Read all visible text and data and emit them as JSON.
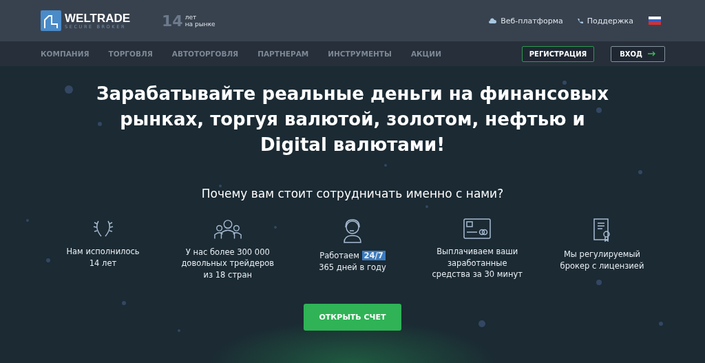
{
  "logo": {
    "name": "WELTRADE",
    "tagline": "SECURE BROKER"
  },
  "years": {
    "number": "14",
    "line1": "лет",
    "line2": "на рынке"
  },
  "top_links": [
    {
      "label": "Веб-платформа",
      "kind": "cloud"
    },
    {
      "label": "Поддержка",
      "kind": "phone"
    }
  ],
  "nav": [
    "КОМПАНИЯ",
    "ТОРГОВЛЯ",
    "АВТОТОРГОВЛЯ",
    "ПАРТНЕРАМ",
    "ИНСТРУМЕНТЫ",
    "АКЦИИ"
  ],
  "register_button": "РЕГИСТРАЦИЯ",
  "login_button": "ВХОД",
  "headline": "Зарабатывайте реальные деньги на финансовых рынках, торгуя валютой, золотом, нефтью и Digital валютами!",
  "subheadline": "Почему вам стоит сотрудничать именно с нами?",
  "features": [
    {
      "lines": [
        "Нам исполнилось",
        "14 лет"
      ]
    },
    {
      "lines": [
        "У нас более 300 000",
        "довольных трейдеров",
        "из 18 стран"
      ]
    },
    {
      "lines": [
        "Работаем",
        "365 дней в году"
      ],
      "badge": "24/7"
    },
    {
      "lines": [
        "Выплачиваем ваши",
        "заработанные",
        "средства за 30 минут"
      ]
    },
    {
      "lines": [
        "Мы регулируемый",
        "брокер с лицензией"
      ]
    }
  ],
  "cta_button": "ОТКРЫТЬ СЧЕТ"
}
